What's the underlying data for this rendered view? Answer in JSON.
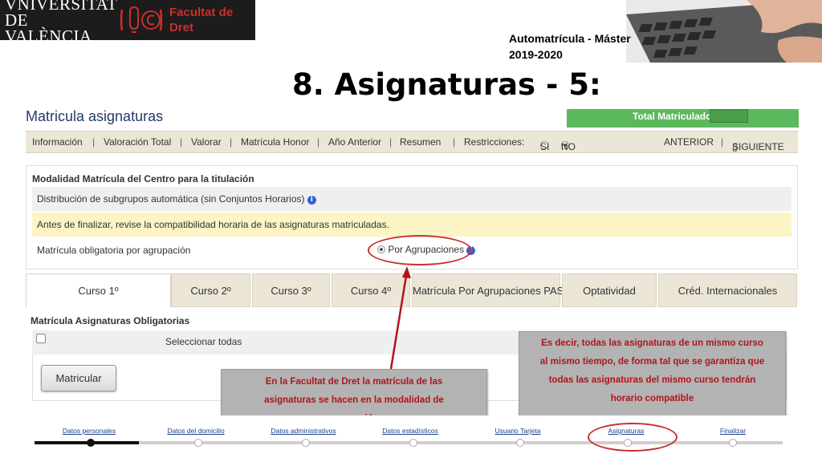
{
  "logo": {
    "university_line1": "VNIVERSITAT",
    "university_line2": "DE VALÈNCIA",
    "faculty_line1": "Facultat de",
    "faculty_line2": "Dret"
  },
  "header": {
    "note_line1": "Automatrícula - Máster",
    "note_line2": "2019-2020",
    "title": "8. Asignaturas - 5:"
  },
  "screen": {
    "title": "Matricula asignaturas",
    "total_label": "Total Matriculado",
    "menu": {
      "informacion": "Información",
      "valoracion_total": "Valoración Total",
      "valorar": "Valorar",
      "matricula_honor": "Matrícula Honor",
      "ano_anterior": "Año Anterior",
      "resumen": "Resumen",
      "restricciones": "Restricciones:",
      "si": "SI",
      "no": "NO",
      "anterior": "ANTERIOR",
      "siguiente": "SIGUIENTE"
    },
    "modalidad": {
      "title": "Modalidad Matrícula del Centro para la titulación",
      "row1": "Distribución de subgrupos automática (sin Conjuntos Horarios)",
      "row2": "Antes de finalizar, revise la compatibilidad horaria de las asignaturas matriculadas.",
      "row3": "Matrícula obligatoria por agrupación",
      "option": "Por Agrupaciones"
    },
    "tabs": [
      {
        "label": "Curso 1º"
      },
      {
        "label": "Curso 2º"
      },
      {
        "label": "Curso 3º"
      },
      {
        "label": "Curso 4º"
      },
      {
        "label": "Matrícula Por Agrupaciones PAS"
      },
      {
        "label": "Optatividad"
      },
      {
        "label": "Créd. Internacionales"
      }
    ],
    "obligatorias_title": "Matrícula Asignaturas Obligatorias",
    "select_all": "Seleccionar todas",
    "matricular_button": "Matricular"
  },
  "callouts": {
    "left": [
      "En la Facultat de Dret la matrícula de las",
      "asignaturas se hacen en la modalidad de",
      "agrupación"
    ],
    "right": [
      "Es decir, todas las asignaturas de un mismo curso",
      "al mismo tiempo, de forma tal que se garantiza que",
      "todas las asignaturas del mismo curso tendrán",
      "horario compatible"
    ]
  },
  "wizard": {
    "steps": [
      {
        "label": "Datos personales"
      },
      {
        "label": "Datos del domicilio"
      },
      {
        "label": "Datos administrativos"
      },
      {
        "label": "Datos estadísticos"
      },
      {
        "label": "Usuario Tarjeta"
      },
      {
        "label": "Asignaturas"
      },
      {
        "label": "Finalizar"
      }
    ]
  },
  "colors": {
    "accent_red": "#c9302c",
    "total_green": "#5cb85c",
    "menu_bg": "#ebe6d6",
    "warning_bg": "#fcf4c4"
  }
}
